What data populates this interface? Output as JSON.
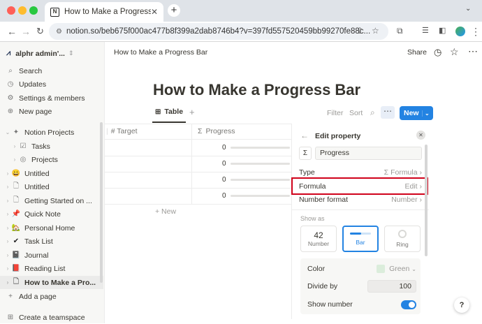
{
  "browser": {
    "tab_title": "How to Make a Progress Bar",
    "url": "notion.so/beb675f000ac477b8f399a2dab8746b4?v=397fd557520459bb99270fe88c..."
  },
  "sidebar": {
    "workspace": "alphr admin'...",
    "nav": [
      "Search",
      "Updates",
      "Settings & members",
      "New page"
    ],
    "pages": [
      {
        "label": "Notion Projects",
        "icon": "✦"
      },
      {
        "label": "Tasks",
        "icon": "☑"
      },
      {
        "label": "Projects",
        "icon": "◎"
      },
      {
        "label": "Untitled",
        "icon": "😀"
      },
      {
        "label": "Untitled",
        "icon": "🗋"
      },
      {
        "label": "Getting Started on ...",
        "icon": "🗋"
      },
      {
        "label": "Quick Note",
        "icon": "📌"
      },
      {
        "label": "Personal Home",
        "icon": "🏡"
      },
      {
        "label": "Task List",
        "icon": "✔"
      },
      {
        "label": "Journal",
        "icon": "📓"
      },
      {
        "label": "Reading List",
        "icon": "📕"
      },
      {
        "label": "How to Make a Pro...",
        "icon": "🗋"
      }
    ],
    "add_page": "Add a page",
    "create_teamspace": "Create a teamspace"
  },
  "topbar": {
    "breadcrumb": "How to Make a Progress Bar",
    "share": "Share"
  },
  "page": {
    "title": "How to Make a Progress Bar"
  },
  "db": {
    "view_tab": "Table",
    "filter": "Filter",
    "sort": "Sort",
    "new_button": "New",
    "columns": [
      "# Target",
      "Progress"
    ],
    "rows": [
      "0",
      "0",
      "0",
      "0"
    ],
    "new_row": "+ New"
  },
  "panel": {
    "header": "Edit property",
    "name_value": "Progress",
    "type_label": "Type",
    "type_value": "Σ Formula",
    "formula_label": "Formula",
    "formula_value": "Edit",
    "number_format_label": "Number format",
    "number_format_value": "Number",
    "show_as": "Show as",
    "cards": [
      {
        "top": "42",
        "label": "Number"
      },
      {
        "top": "",
        "label": "Bar"
      },
      {
        "top": "",
        "label": "Ring"
      }
    ],
    "color_label": "Color",
    "color_value": "Green",
    "divide_label": "Divide by",
    "divide_value": "100",
    "show_number_label": "Show number"
  },
  "help": "?",
  "colors": {
    "accent": "#2383e2",
    "highlight": "#d0021b",
    "green_swatch": "#dbeddb"
  }
}
